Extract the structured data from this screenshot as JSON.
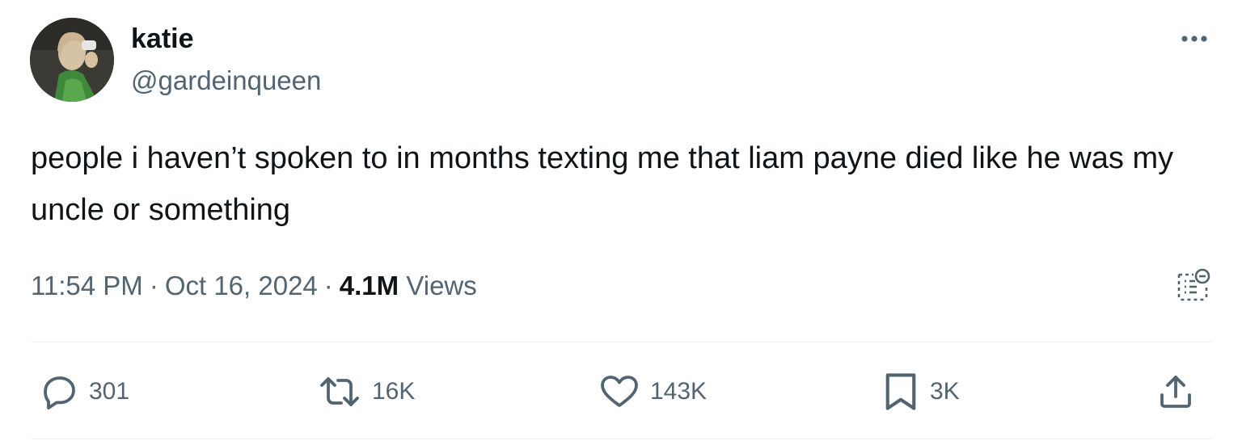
{
  "author": {
    "display_name": "katie",
    "handle": "@gardeinqueen"
  },
  "tweet": {
    "text": "people i haven’t spoken to in months texting me that liam payne died like he was my uncle or something",
    "time": "11:54 PM",
    "date": "Oct 16, 2024",
    "separator": "·",
    "views_count": "4.1M",
    "views_label": "Views"
  },
  "actions": {
    "replies": "301",
    "reposts": "16K",
    "likes": "143K",
    "bookmarks": "3K"
  },
  "icons": {
    "more": "more-horizontal-icon",
    "community_notes": "community-notes-icon",
    "reply": "reply-icon",
    "repost": "repost-icon",
    "like": "heart-icon",
    "bookmark": "bookmark-icon",
    "share": "share-icon"
  },
  "colors": {
    "text_primary": "#0f1419",
    "text_secondary": "#536471",
    "divider": "#eff3f4"
  }
}
